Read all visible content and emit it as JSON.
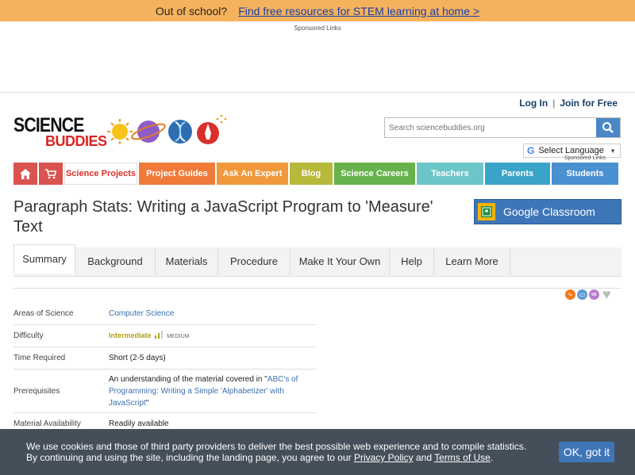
{
  "promo": {
    "question": "Out of school?",
    "link": "Find free resources for STEM learning at home  >"
  },
  "sponsored_top": "Sponsored Links",
  "auth": {
    "login": "Log In",
    "separator": "|",
    "join": "Join for Free"
  },
  "logo": {
    "line1": "SCIENCE",
    "line2": "BUDDIES"
  },
  "search": {
    "placeholder": "Search sciencebuddies.org"
  },
  "translate": {
    "label": "Select Language",
    "sponsored": "Sponsored Links"
  },
  "nav": {
    "items": [
      {
        "label": "",
        "icon": "home-icon",
        "color": "#d9534f"
      },
      {
        "label": "",
        "icon": "cart-icon",
        "color": "#d9534f"
      },
      {
        "label": "Science Projects",
        "color": "#ffffff"
      },
      {
        "label": "Project Guides",
        "color": "#f07a3a"
      },
      {
        "label": "Ask An Expert",
        "color": "#f0983a"
      },
      {
        "label": "Blog",
        "color": "#b7b93a"
      },
      {
        "label": "Science Careers",
        "color": "#67b24a"
      },
      {
        "label": "Teachers",
        "color": "#6cc6c9"
      },
      {
        "label": "Parents",
        "color": "#3aa3c8"
      },
      {
        "label": "Students",
        "color": "#4a8fcf"
      }
    ]
  },
  "page": {
    "title": "Paragraph Stats: Writing a JavaScript Program to 'Measure' Text"
  },
  "google_classroom": {
    "label": "Google Classroom"
  },
  "tabs": [
    "Summary",
    "Background",
    "Materials",
    "Procedure",
    "Make It Your Own",
    "Help",
    "Learn More"
  ],
  "info": {
    "areas_label": "Areas of Science",
    "areas_value": "Computer Science",
    "difficulty_label": "Difficulty",
    "difficulty_value": "Intermediate",
    "difficulty_level": "MEDIUM",
    "time_label": "Time Required",
    "time_value": "Short (2-5 days)",
    "prereq_label": "Prerequisites",
    "prereq_pre": "An understanding of the material covered in \"",
    "prereq_link": "ABC's of Programming: Writing a Simple 'Alphabetizer' with JavaScript",
    "prereq_post": "\"",
    "material_label": "Material Availability",
    "material_value": "Readily available"
  },
  "cookie": {
    "line1": "We use cookies and those of third party providers to deliver the best possible web experience and to compile statistics.",
    "line2_pre": "By continuing and using the site, including the landing page, you agree to our ",
    "privacy": "Privacy Policy",
    "and": " and ",
    "terms": "Terms of Use",
    "end": ".",
    "ok": "OK, got it"
  }
}
